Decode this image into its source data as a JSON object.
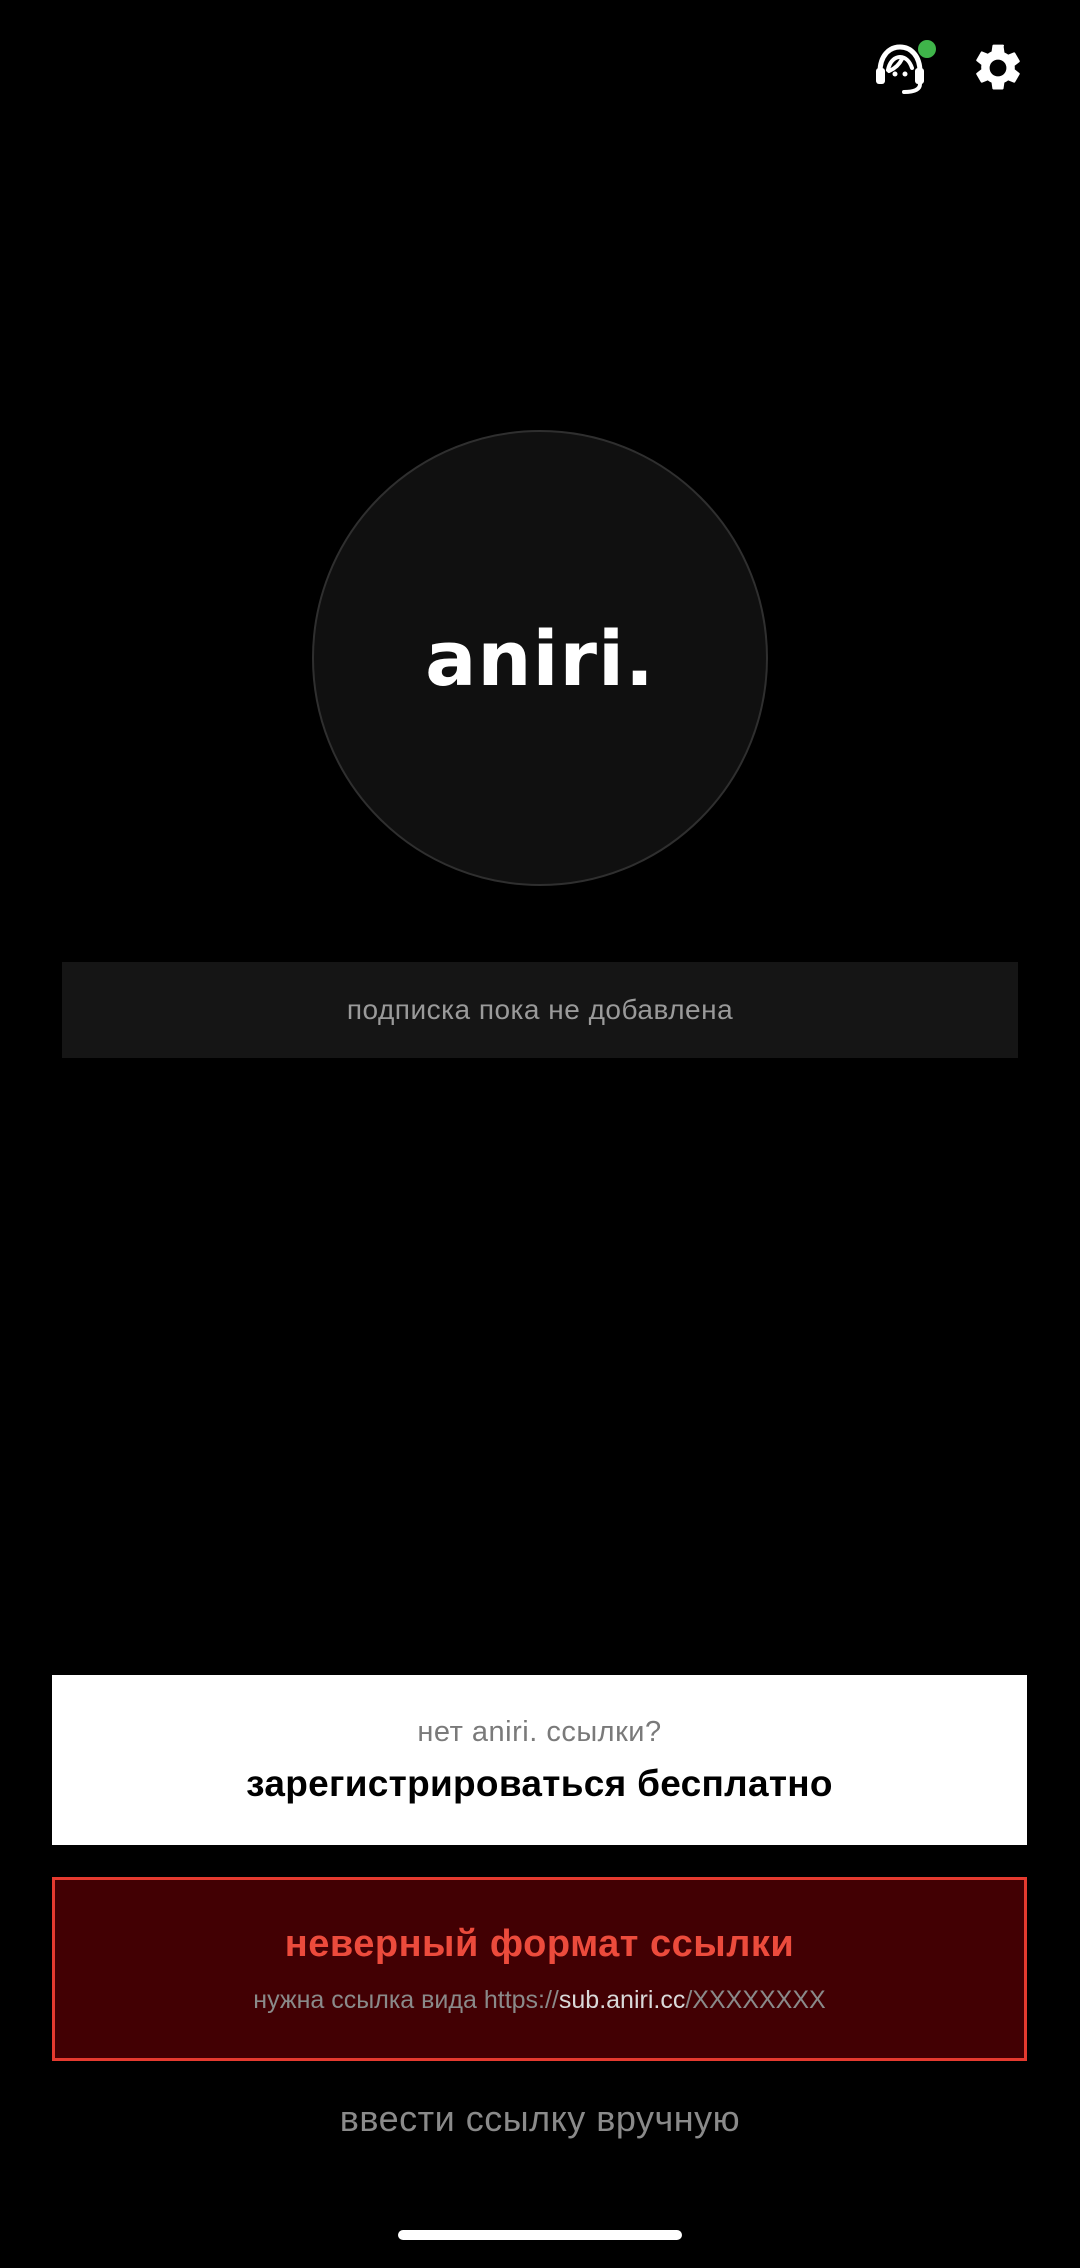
{
  "header": {
    "support_icon": "support-headset-icon",
    "settings_icon": "gear-icon",
    "online_color": "#3fb54a"
  },
  "logo": {
    "text": "aniri."
  },
  "subscription": {
    "status": "подписка пока не добавлена"
  },
  "register": {
    "question": "нет aniri. ссылки?",
    "action": "зарегистрироваться бесплатно"
  },
  "error": {
    "title": "неверный формат ссылки",
    "hint_prefix": "нужна ссылка вида https://",
    "hint_domain": "sub.aniri.cc",
    "hint_suffix": "/XXXXXXXX",
    "color": "#ec4b3c"
  },
  "manual": {
    "label": "ввести ссылку вручную"
  }
}
